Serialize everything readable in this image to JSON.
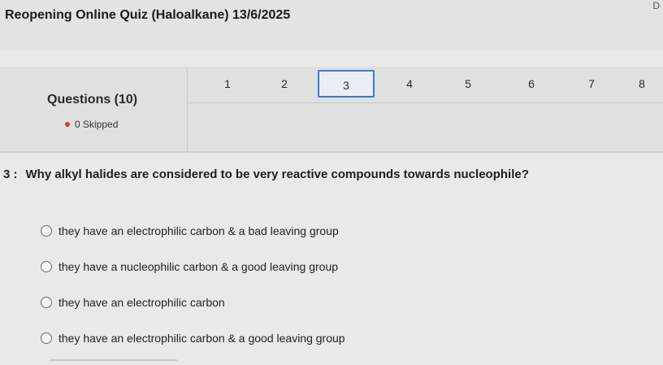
{
  "header": {
    "title": "Reopening Online Quiz (Haloalkane) 13/6/2025",
    "corner_mark": "D"
  },
  "summary": {
    "questions_label": "Questions (10)",
    "skipped_label": "0 Skipped"
  },
  "question_nav": {
    "items": [
      "1",
      "2",
      "3",
      "4",
      "5",
      "6",
      "7",
      "8"
    ],
    "active_index": 2
  },
  "question": {
    "number": "3 :",
    "text": "Why alkyl halides are considered to be very reactive compounds towards nucleophile?",
    "options": [
      "they have an electrophilic carbon & a bad leaving group",
      "they have a nucleophilic carbon & a good leaving group",
      "they have an electrophilic carbon",
      "they have an electrophilic carbon & a good leaving group"
    ]
  }
}
